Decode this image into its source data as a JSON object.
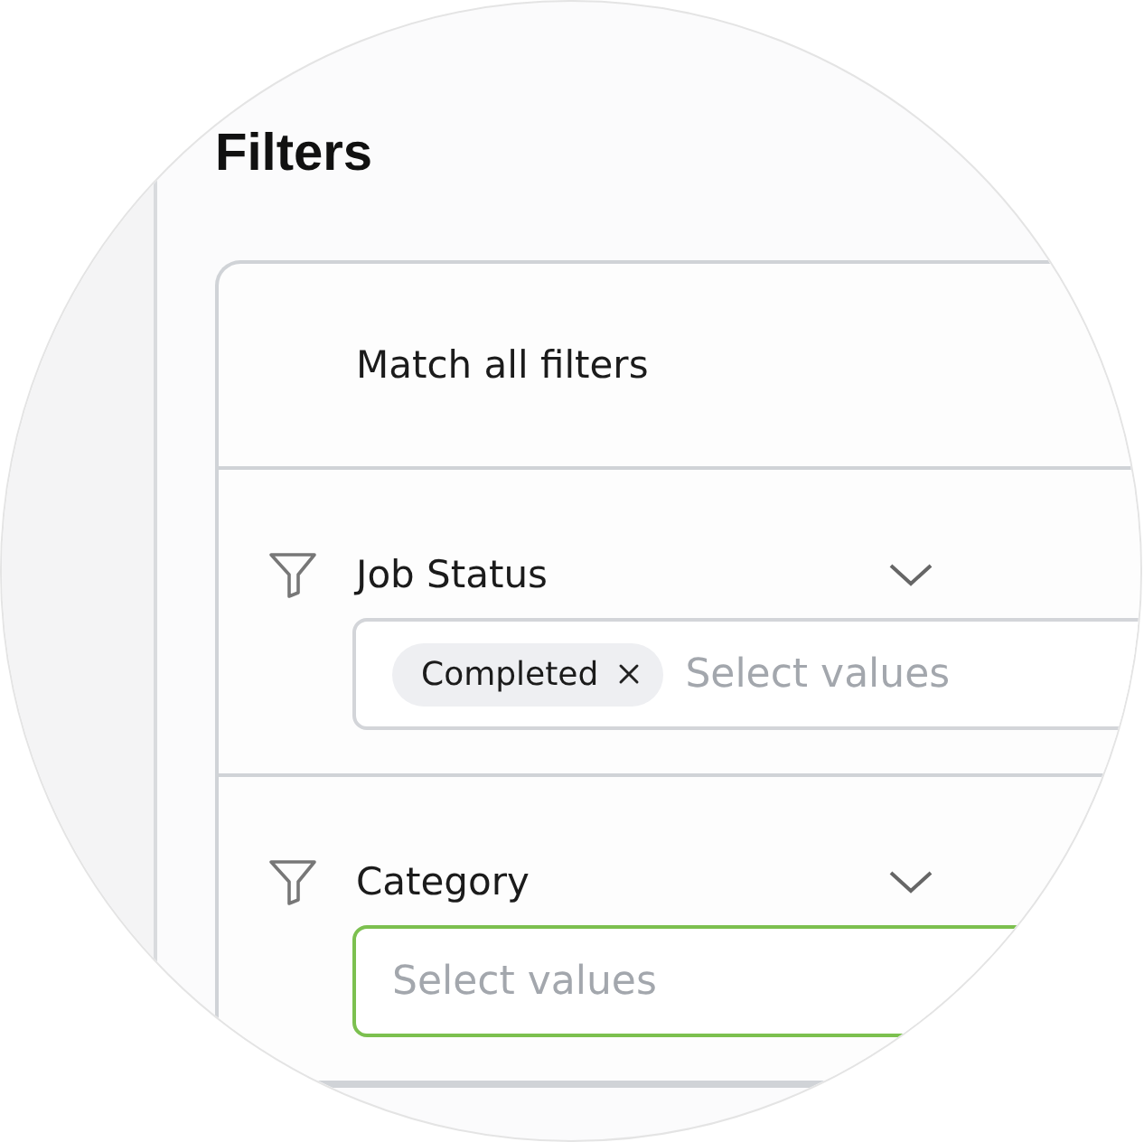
{
  "title": "Filters",
  "match_label": "Match all filters",
  "filters": [
    {
      "label": "Job Status",
      "chips": [
        "Completed"
      ],
      "placeholder": "Select values",
      "focused": false
    },
    {
      "label": "Category",
      "placeholder": "Select values",
      "focused": true
    }
  ]
}
